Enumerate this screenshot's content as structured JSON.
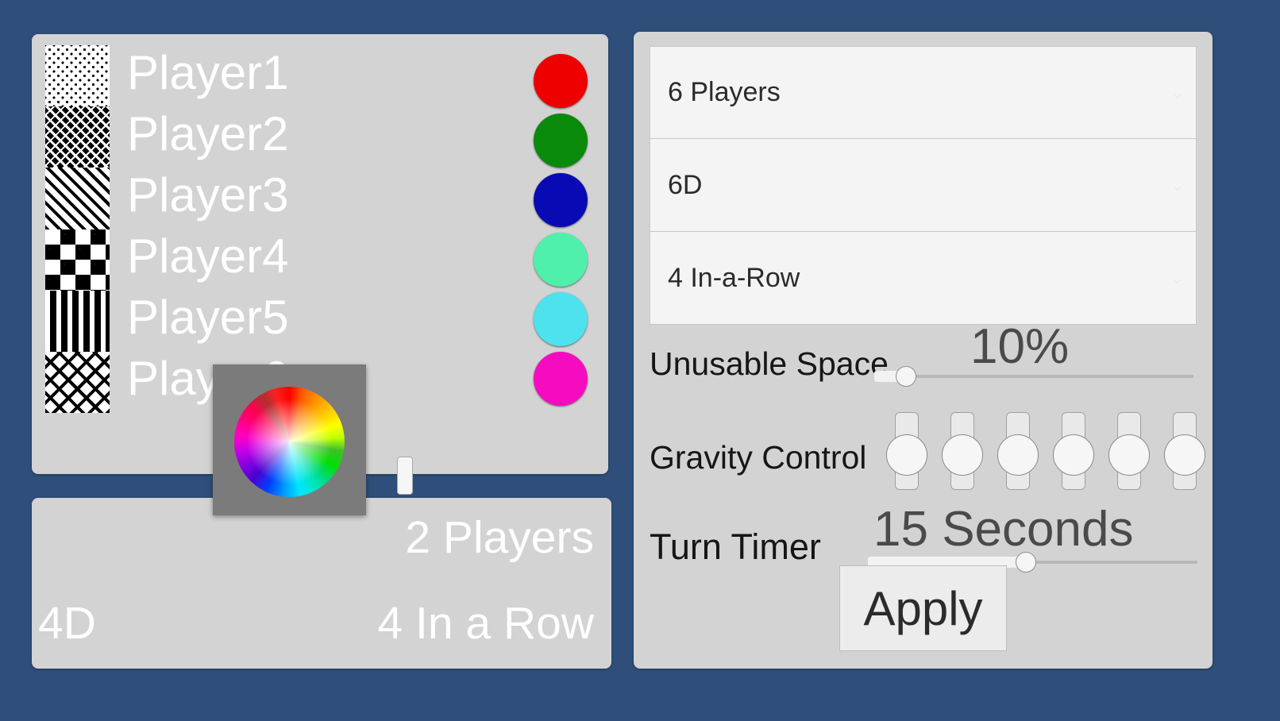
{
  "background_color": "#2f4f7a",
  "players_panel": {
    "patterns": [
      {
        "name": "dots-pattern"
      },
      {
        "name": "weave-pattern"
      },
      {
        "name": "diagonal-stripes-pattern"
      },
      {
        "name": "checkerboard-pattern"
      },
      {
        "name": "vertical-bars-pattern"
      },
      {
        "name": "diamond-pattern"
      }
    ],
    "players": [
      {
        "name": "Player1",
        "color": "#ee0000"
      },
      {
        "name": "Player2",
        "color": "#0a8a0a"
      },
      {
        "name": "Player3",
        "color": "#0a0ab4"
      },
      {
        "name": "Player4",
        "color": "#4ef0ab"
      },
      {
        "name": "Player5",
        "color": "#4de2ee"
      },
      {
        "name": "Player6",
        "color": "#f50cc0"
      }
    ]
  },
  "color_picker": {
    "title": "color-wheel-picker"
  },
  "summary_panel": {
    "players": "2 Players",
    "dimension": "4D",
    "mode": "4 In a Row"
  },
  "settings_panel": {
    "selects": [
      {
        "name": "player-count-select",
        "value": "6 Players",
        "chevron": "⌄"
      },
      {
        "name": "dimension-select",
        "value": "6D",
        "chevron": "⌄"
      },
      {
        "name": "win-condition-select",
        "value": "4 In-a-Row",
        "chevron": "⌄"
      }
    ],
    "unusable_space": {
      "label": "Unusable Space",
      "value": "10%",
      "percent": 10
    },
    "gravity_control": {
      "label": "Gravity Control",
      "columns": 6
    },
    "turn_timer": {
      "label": "Turn Timer",
      "value": "15 Seconds",
      "percent": 48
    },
    "apply_label": "Apply"
  }
}
